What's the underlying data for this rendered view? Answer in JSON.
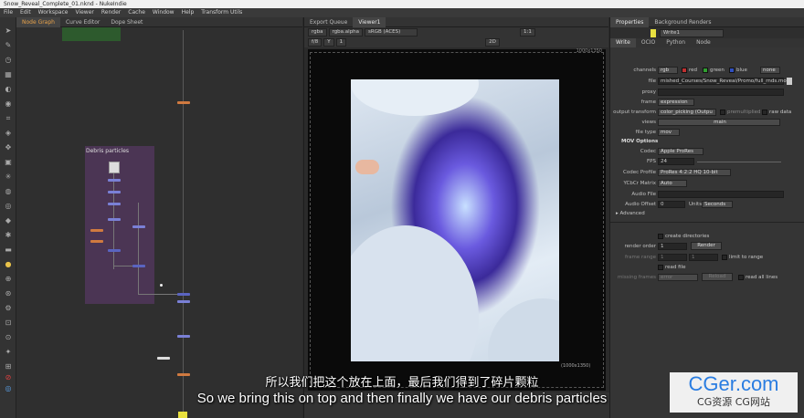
{
  "window": {
    "title": "Snow_Reveal_Complete_01.nknd - NukeIndie"
  },
  "menu": [
    "File",
    "Edit",
    "Workspace",
    "Viewer",
    "Render",
    "Cache",
    "Window",
    "Help",
    "Transform Utils"
  ],
  "graph_tabs": [
    "Node Graph",
    "Curve Editor",
    "Dope Sheet"
  ],
  "viewer_tabs": [
    "Export Queue",
    "Viewer1"
  ],
  "viewer": {
    "channels": "rgba",
    "alpha": "rgba.alpha",
    "colorspace": "sRGB (ACES)",
    "fstop": "f/8",
    "frame_y": "Y",
    "frame_val": "1",
    "ratio": "1:1",
    "mode": "2D",
    "resolution": "(1000x1350)",
    "res_top": "1000x1350"
  },
  "backdrop": {
    "label": "Debris particles"
  },
  "props_tabs": [
    "Properties",
    "Background Renders"
  ],
  "props": {
    "node_name": "Write1",
    "tabs": [
      "Write",
      "OCIO",
      "Python",
      "Node"
    ],
    "channels_label": "channels",
    "channels_val": "rgb",
    "red": "red",
    "green": "green",
    "blue": "blue",
    "none": "none",
    "file_label": "file",
    "file_val": "mished_Courses/Snow_Reveal/Promo/full_rnds.mov",
    "proxy_label": "proxy",
    "frame_label": "frame",
    "frame_val": "expression",
    "ot_label": "output transform",
    "ot_val": "color_picking (Outpu",
    "premult": "premultiplied",
    "raw": "raw data",
    "views_label": "views",
    "views_val": "main",
    "ft_label": "file type",
    "ft_val": "mov",
    "mov_header": "MOV Options",
    "codec_label": "Codec",
    "codec_val": "Apple ProRes",
    "fps_label": "FPS",
    "fps_val": "24",
    "cp_label": "Codec Profile",
    "cp_val": "ProRes 4:2:2 HQ 10-bit",
    "ycbcr_label": "YCbCr Matrix",
    "ycbcr_val": "Auto",
    "af_label": "Audio File",
    "ao_label": "Audio Offset",
    "ao_val": "0",
    "units_label": "Units",
    "units_val": "Seconds",
    "advanced": "Advanced",
    "create_dirs": "create directories",
    "ro_label": "render order",
    "ro_val": "1",
    "render_btn": "Render",
    "fr_label": "frame range",
    "fr_a": "1",
    "fr_b": "1",
    "limit": "limit to range",
    "read_file": "read file",
    "mf_label": "missing frames",
    "mf_val": "error",
    "reload": "Reload",
    "read_all": "read all lines"
  },
  "subtitles": {
    "cn": "所以我们把这个放在上面，最后我们得到了碎片颗粒",
    "en": "So we bring this on top and then finally we have our debris particles"
  },
  "watermark": {
    "main": "CGer.com",
    "sub": "CG资源  CG网站"
  },
  "colors": {
    "accent": "#e8a24a",
    "backdrop": "#4b3554",
    "watermark": "#2a7de1"
  }
}
